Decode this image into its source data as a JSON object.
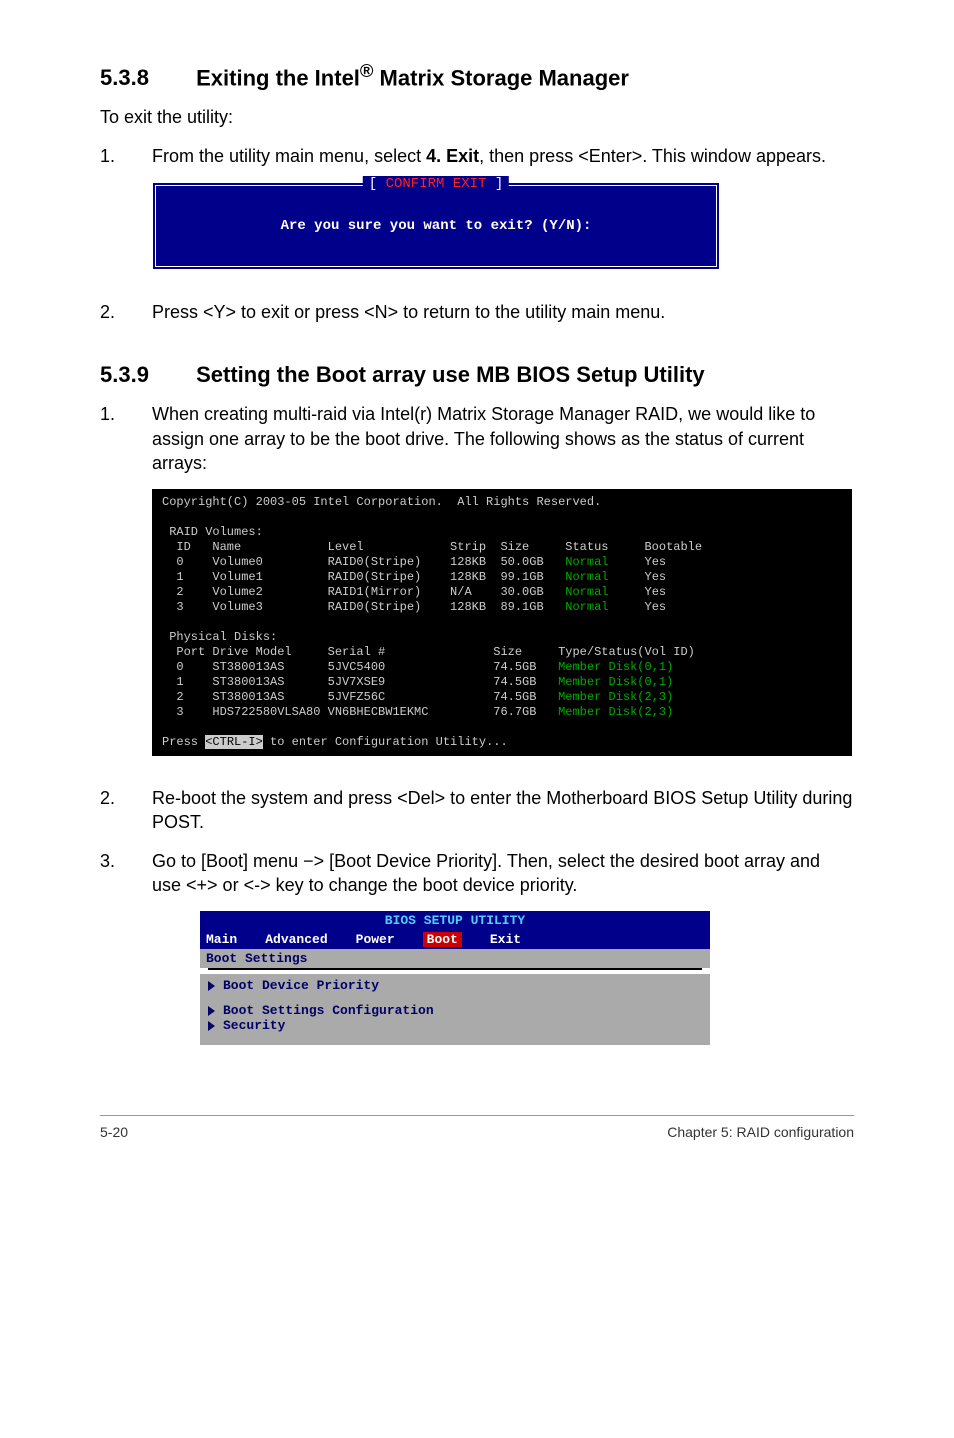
{
  "sec1": {
    "num": "5.3.8",
    "title_a": "Exiting the Intel",
    "title_b": " Matrix Storage Manager",
    "intro": "To exit the utility:",
    "step1_num": "1.",
    "step1_a": "From the utility main menu, select ",
    "step1_b": "4. Exit",
    "step1_c": ", then press <Enter>. This window appears.",
    "confirm_brackets_l": "[ ",
    "confirm_title": "CONFIRM EXIT",
    "confirm_brackets_r": " ]",
    "confirm_msg": "Are you sure you want to exit? (Y/N):",
    "step2_num": "2.",
    "step2": "Press <Y> to exit or press <N> to return to the utility main menu."
  },
  "sec2": {
    "num": "5.3.9",
    "title": "Setting the Boot array use MB BIOS Setup Utility",
    "step1_num": "1.",
    "step1": "When creating multi-raid via Intel(r) Matrix Storage Manager RAID, we would like to assign one array to be the boot drive. The following shows as the status of current arrays:",
    "step2_num": "2.",
    "step2": "Re-boot the system and press <Del> to enter the Motherboard BIOS Setup Utility during POST.",
    "step3_num": "3.",
    "step3": "Go to [Boot] menu −> [Boot Device Priority]. Then, select the desired boot array and use <+> or <-> key to change the boot device priority."
  },
  "raid": {
    "copyright": "Copyright(C) 2003-05 Intel Corporation.  All Rights Reserved.",
    "vol_header": " RAID Volumes:",
    "vol_cols": "  ID   Name            Level            Strip  Size     Status     Bootable",
    "vol0": "  0    Volume0         RAID0(Stripe)    128KB  50.0GB   ",
    "vol0_s": "Normal",
    "vol0_b": "     Yes",
    "vol1": "  1    Volume1         RAID0(Stripe)    128KB  99.1GB   ",
    "vol1_s": "Normal",
    "vol1_b": "     Yes",
    "vol2": "  2    Volume2         RAID1(Mirror)    N/A    30.0GB   ",
    "vol2_s": "Normal",
    "vol2_b": "     Yes",
    "vol3": "  3    Volume3         RAID0(Stripe)    128KB  89.1GB   ",
    "vol3_s": "Normal",
    "vol3_b": "     Yes",
    "phys_header": " Physical Disks:",
    "phys_cols": "  Port Drive Model     Serial #               Size     Type/Status(Vol ID)",
    "p0": "  0    ST380013AS      5JVC5400               74.5GB   ",
    "p0_s": "Member Disk(0,1)",
    "p1": "  1    ST380013AS      5JV7XSE9               74.5GB   ",
    "p1_s": "Member Disk(0,1)",
    "p2": "  2    ST380013AS      5JVFZ56C               74.5GB   ",
    "p2_s": "Member Disk(2,3)",
    "p3": "  3    HDS722580VLSA80 VN6BHECBW1EKMC         76.7GB   ",
    "p3_s": "Member Disk(2,3)",
    "press_a": "Press ",
    "press_key": "<CTRL-I>",
    "press_b": " to enter Configuration Utility..."
  },
  "bios": {
    "util_title": "BIOS SETUP UTILITY",
    "menu": {
      "main": "Main",
      "advanced": "Advanced",
      "power": "Power",
      "boot": "Boot",
      "exit": "Exit"
    },
    "sub": "Boot Settings",
    "item1": "Boot Device Priority",
    "item2": "Boot Settings Configuration",
    "item3": "Security"
  },
  "footer": {
    "left": "5-20",
    "right": "Chapter 5: RAID configuration"
  }
}
